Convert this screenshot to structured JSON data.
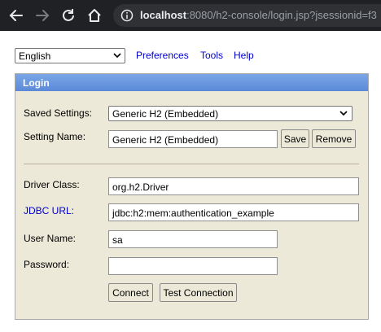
{
  "browser": {
    "url_host": "localhost",
    "url_rest": ":8080/h2-console/login.jsp?jsessionid=f3",
    "icons": [
      "back-arrow-icon",
      "forward-arrow-icon",
      "reload-icon",
      "home-icon",
      "info-icon"
    ]
  },
  "menu": {
    "language": "English",
    "preferences": "Preferences",
    "tools": "Tools",
    "help": "Help"
  },
  "login": {
    "title": "Login",
    "saved_settings_label": "Saved Settings:",
    "saved_settings_value": "Generic H2 (Embedded)",
    "setting_name_label": "Setting Name:",
    "setting_name_value": "Generic H2 (Embedded)",
    "save_button": "Save",
    "remove_button": "Remove",
    "driver_class_label": "Driver Class:",
    "driver_class_value": "org.h2.Driver",
    "jdbc_url_label": "JDBC URL:",
    "jdbc_url_value": "jdbc:h2:mem:authentication_example",
    "user_name_label": "User Name:",
    "user_name_value": "sa",
    "password_label": "Password:",
    "password_value": "",
    "connect_button": "Connect",
    "test_connection_button": "Test Connection"
  },
  "colors": {
    "panel_background": "#ece9d8",
    "header_blue": "#6b98df",
    "link_blue": "#0000cc",
    "browser_dark": "#202124"
  }
}
